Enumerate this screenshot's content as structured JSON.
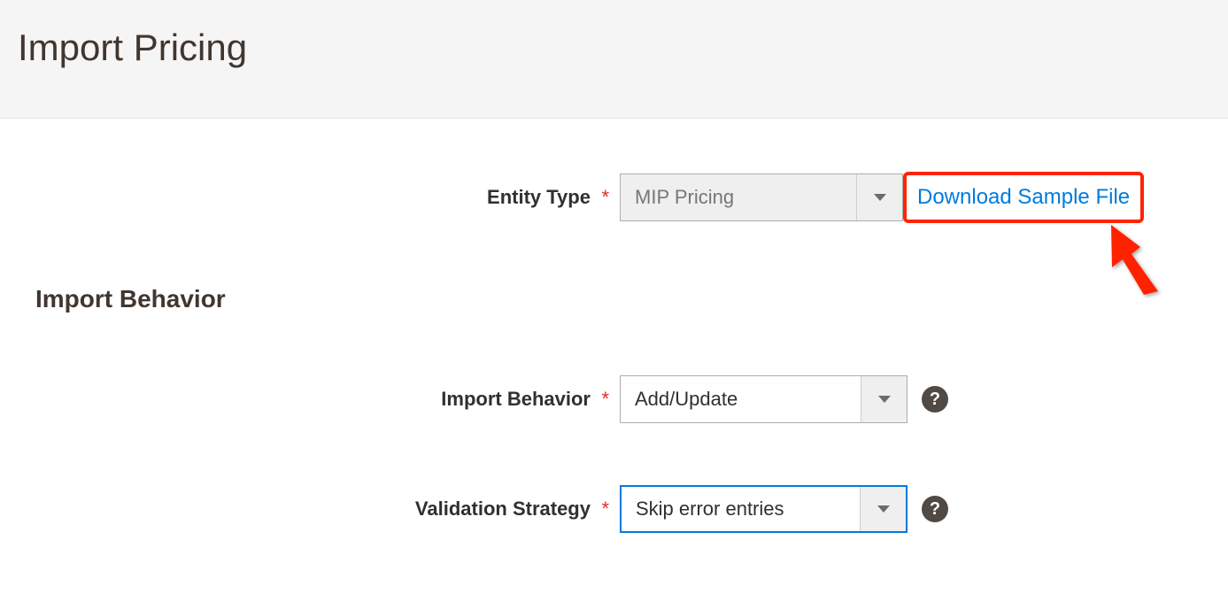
{
  "header": {
    "title": "Import Pricing"
  },
  "form": {
    "entity_type": {
      "label": "Entity Type",
      "value": "MIP Pricing",
      "download_sample_label": "Download Sample File"
    },
    "section_heading": "Import Behavior",
    "import_behavior": {
      "label": "Import Behavior",
      "value": "Add/Update"
    },
    "validation_strategy": {
      "label": "Validation Strategy",
      "value": "Skip error entries"
    },
    "required_mark": "*",
    "help_glyph": "?"
  }
}
